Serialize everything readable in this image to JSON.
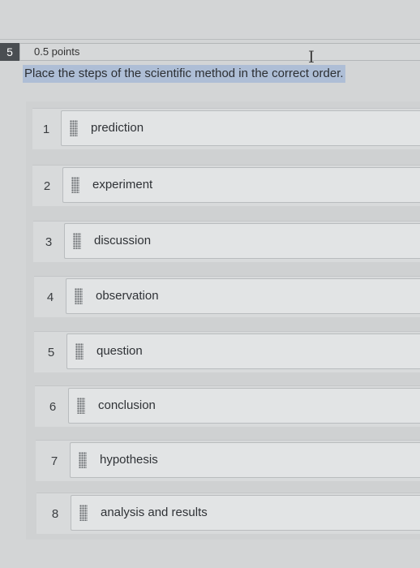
{
  "question": {
    "number": "5",
    "points": "0.5 points",
    "prompt": "Place the steps of the scientific method in the correct order."
  },
  "items": [
    {
      "number": "1",
      "label": "prediction"
    },
    {
      "number": "2",
      "label": "experiment"
    },
    {
      "number": "3",
      "label": "discussion"
    },
    {
      "number": "4",
      "label": "observation"
    },
    {
      "number": "5",
      "label": "question"
    },
    {
      "number": "6",
      "label": "conclusion"
    },
    {
      "number": "7",
      "label": "hypothesis"
    },
    {
      "number": "8",
      "label": "analysis and results"
    }
  ],
  "icons": {
    "drag_handle": "drag-handle-icon",
    "cursor": "text-cursor-icon"
  },
  "colors": {
    "selection": "#aebed6",
    "question_number_bg": "#4a4e52"
  }
}
